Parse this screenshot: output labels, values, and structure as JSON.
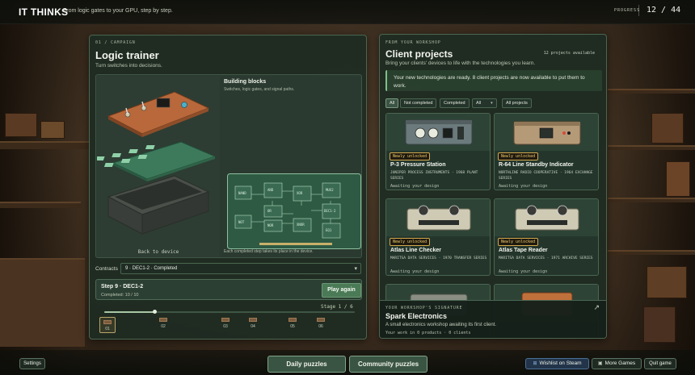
{
  "header": {
    "brand": "IT THINKS",
    "tagline": "From logic gates to your GPU, step by step.",
    "progress_label": "PROGRESS",
    "progress_value": "12 / 44"
  },
  "campaign": {
    "crumb": "01 / CAMPAIGN",
    "title": "Logic trainer",
    "subtitle": "Turn switches into decisions.",
    "back_to_device": "Back to device",
    "building_blocks_title": "Building blocks",
    "building_blocks_sub": "Switches, logic gates, and signal paths.",
    "building_blocks_note": "Each completed step takes its place in the device.",
    "pcb_chips": [
      "NAND",
      "AND",
      "XOR",
      "MUX2",
      "OR",
      "DEC1-2",
      "NOT",
      "NOR",
      "XNOR",
      "EQ1"
    ],
    "contracts_label": "Contracts",
    "contracts_selected": "9 · DEC1-2 · Completed",
    "step_title": "Step 9 · DEC1-2",
    "step_completed": "Completed: 10 / 10",
    "play_again": "Play again",
    "stage_label": "Stage 1 / 6",
    "stage_progress": 0.2,
    "stages": [
      "01",
      "02",
      "03",
      "04",
      "05",
      "06"
    ]
  },
  "clients": {
    "crumb": "FROM YOUR WORKSHOP",
    "title": "Client projects",
    "count": "12 projects available",
    "subtitle": "Bring your clients' devices to life with the technologies you learn.",
    "banner": "Your new technologies are ready. 8 client projects are now available to put them to work.",
    "filters": {
      "all": "All",
      "not_completed": "Not completed",
      "completed": "Completed",
      "dropdown": "All",
      "all_projects": "All projects"
    },
    "cards": [
      {
        "badge": "Newly unlocked",
        "title": "P-3 Pressure Station",
        "meta": "JUNIPER PROCESS INSTRUMENTS · 1968 PLANT SERIES",
        "status": "Awaiting your design"
      },
      {
        "badge": "Newly unlocked",
        "title": "R-64 Line Standby Indicator",
        "meta": "NORTHLINE RADIO COOPERATIVE · 1964 EXCHANGE SERIES",
        "status": "Awaiting your design"
      },
      {
        "badge": "Newly unlocked",
        "title": "Atlas Line Checker",
        "meta": "MARITSA DATA SERVICES · 1970 TRANSFER SERIES",
        "status": "Awaiting your design"
      },
      {
        "badge": "Newly unlocked",
        "title": "Atlas Tape Reader",
        "meta": "MARITSA DATA SERVICES · 1971 ARCHIVE SERIES",
        "status": "Awaiting your design"
      }
    ],
    "signature": {
      "label": "YOUR WORKSHOP'S SIGNATURE",
      "title": "Spark Electronics",
      "description": "A small electronics workshop awaiting its first client.",
      "stats": "Your work in 0 products · 0 clients"
    }
  },
  "footer": {
    "settings": "Settings",
    "daily": "Daily puzzles",
    "community": "Community puzzles",
    "steam": "Wishlist on Steam",
    "more": "More Games",
    "quit": "Quit game"
  },
  "colors": {
    "accent": "#4a7a56",
    "badge": "#f0c968",
    "panel": "#1e2c22"
  }
}
